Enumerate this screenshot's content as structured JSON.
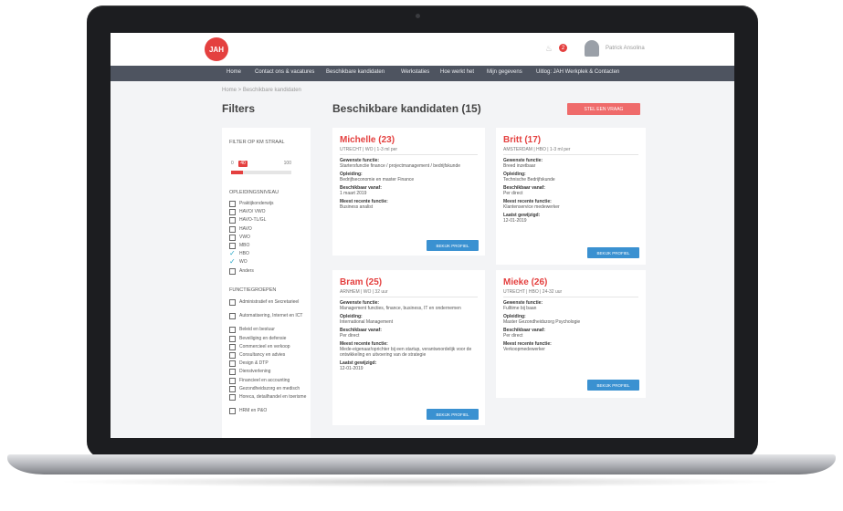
{
  "app": {
    "logo_text": "JAH",
    "notification_count": "2",
    "user_name": "Patrick Ansolina"
  },
  "nav": {
    "items": [
      "Home",
      "Contact ons & vacatures",
      "Beschikbare kandidaten",
      "Werkstaties",
      "Hoe werkt het",
      "Mijn gegevens",
      "Uitlog: JAH Werkplek & Contacten"
    ]
  },
  "breadcrumb": "Home > Beschikbare kandidaten",
  "filters": {
    "title": "Filters",
    "radius_label": "FILTER OP KM STRAAL",
    "radius_min": "0",
    "radius_value": "40",
    "radius_max": "100",
    "radius_fraction": 0.2,
    "education_label": "OPLEIDINGSNIVEAU",
    "education": [
      {
        "label": "Praktijkonderwijs",
        "checked": false
      },
      {
        "label": "HAVO/ VWO",
        "checked": false
      },
      {
        "label": "HAVO-TL/GL",
        "checked": false
      },
      {
        "label": "HAVO",
        "checked": false
      },
      {
        "label": "VWO",
        "checked": false
      },
      {
        "label": "MBO",
        "checked": false
      },
      {
        "label": "HBO",
        "checked": true
      },
      {
        "label": "WO",
        "checked": true
      },
      {
        "label": "Anders",
        "checked": false
      }
    ],
    "function_label": "FUNCTIEGROEPEN",
    "functions": [
      {
        "label": "Administratief en Secretarieel",
        "checked": false
      },
      {
        "label": "Automatisering, Internet en ICT",
        "checked": false
      },
      {
        "label": "Beleid en bestuur",
        "checked": false
      },
      {
        "label": "Beveiliging en defensie",
        "checked": false
      },
      {
        "label": "Commercieel en verkoop",
        "checked": false
      },
      {
        "label": "Consultancy en advies",
        "checked": false
      },
      {
        "label": "Design & DTP",
        "checked": false
      },
      {
        "label": "Dienstverlening",
        "checked": false
      },
      {
        "label": "Financieel en accounting",
        "checked": false
      },
      {
        "label": "Gezondheidszorg en medisch",
        "checked": false
      },
      {
        "label": "Horeca, detailhandel en toerisme",
        "checked": false
      },
      {
        "label": "HRM en P&O",
        "checked": false
      }
    ]
  },
  "main": {
    "title": "Beschikbare kandidaten (15)",
    "request_button": "STEL EEN VRAAG"
  },
  "candidates": [
    {
      "name": "Michelle (23)",
      "meta": "UTRECHT | WO | 1-3 ml per",
      "fields": [
        {
          "label": "Gewenste functie:",
          "value": "Startersfunctie finance / projectmanagement / bedrijfskunde"
        },
        {
          "label": "Opleiding:",
          "value": "Bedrijfseconomie en master Finance"
        },
        {
          "label": "Beschikbaar vanaf:",
          "value": "1 maart 2019"
        },
        {
          "label": "Meest recente functie:",
          "value": "Business analist"
        }
      ],
      "button": "BEKIJK PROFIEL"
    },
    {
      "name": "Britt (17)",
      "meta": "AMSTERDAM | HBO | 1-3 ml per",
      "fields": [
        {
          "label": "Gewenste functie:",
          "value": "Breed inzetbaar"
        },
        {
          "label": "Opleiding:",
          "value": "Technische Bedrijfskunde"
        },
        {
          "label": "Beschikbaar vanaf:",
          "value": "Per direct"
        },
        {
          "label": "Meest recente functie:",
          "value": "Klantenservice medewerker"
        },
        {
          "label": "Laatst gewijzigd:",
          "value": "12-01-2019"
        }
      ],
      "button": "BEKIJK PROFIEL"
    },
    {
      "name": "Bram (25)",
      "meta": "ARNHEM | WO | 32 uur",
      "fields": [
        {
          "label": "Gewenste functie:",
          "value": "Management functies, finance, business, IT en ondernemen"
        },
        {
          "label": "Opleiding:",
          "value": "International Management"
        },
        {
          "label": "Beschikbaar vanaf:",
          "value": "Per direct"
        },
        {
          "label": "Meest recente functie:",
          "value": "Mede-eigenaar/oprichter bij een startup, verantwoordelijk voor de ontwikkeling en uitvoering van de strategie"
        },
        {
          "label": "Laatst gewijzigd:",
          "value": "12-01-2019"
        }
      ],
      "button": "BEKIJK PROFIEL"
    },
    {
      "name": "Mieke (26)",
      "meta": "UTRECHT | HBO | 24-32 uur",
      "fields": [
        {
          "label": "Gewenste functie:",
          "value": "Fulltime bij baan"
        },
        {
          "label": "Opleiding:",
          "value": "Master Gezondheidszorg Psychologie"
        },
        {
          "label": "Beschikbaar vanaf:",
          "value": "Per direct"
        },
        {
          "label": "Meest recente functie:",
          "value": "Verkoopmedewerker"
        }
      ],
      "button": "BEKIJK PROFIEL"
    }
  ]
}
